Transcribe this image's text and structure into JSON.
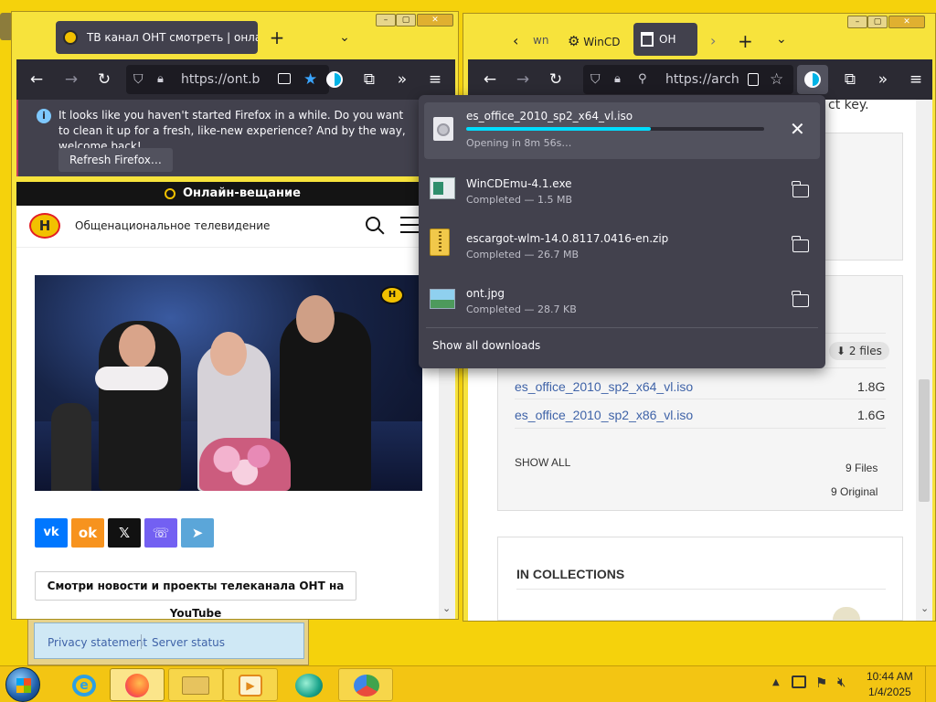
{
  "left_window": {
    "tab_title": "ТВ канал ОНТ смотреть | онлайн",
    "url_text": "https://ont.b",
    "notification": {
      "message": "It looks like you haven't started Firefox in a while. Do you want to clean it up for a fresh, like-new experience? And by the way, welcome back!",
      "button": "Refresh Firefox…"
    },
    "live_bar": "Онлайн-вещание",
    "site_title": "Общенациональное телевидение",
    "share_buttons": [
      "vk",
      "ok",
      "x",
      "viber",
      "telegram"
    ],
    "youtube_button": "Смотри новости и проекты телеканала ОНТ на YouTube"
  },
  "right_window": {
    "tabs": [
      "wn",
      "WinCD",
      "OH"
    ],
    "url_text": "https://arch",
    "page": {
      "top_snippet": "ct key.",
      "files_badge": "2 files",
      "files": [
        {
          "name": "es_office_2010_sp2_x64_vl.iso",
          "size": "1.8G"
        },
        {
          "name": "es_office_2010_sp2_x86_vl.iso",
          "size": "1.6G"
        }
      ],
      "show_all": "SHOW ALL",
      "files_count": "9 Files",
      "original_count": "9 Original",
      "collections_heading": "IN COLLECTIONS"
    }
  },
  "downloads_panel": {
    "items": [
      {
        "name": "es_office_2010_sp2_x64_vl.iso",
        "status": "Opening in 8m 56s…",
        "progress": 0.62,
        "action": "cancel"
      },
      {
        "name": "WinCDEmu-4.1.exe",
        "status": "Completed — 1.5 MB",
        "action": "folder"
      },
      {
        "name": "escargot-wlm-14.0.8117.0416-en.zip",
        "status": "Completed — 26.7 MB",
        "action": "folder"
      },
      {
        "name": "ont.jpg",
        "status": "Completed — 28.7 KB",
        "action": "folder"
      }
    ],
    "show_all": "Show all downloads"
  },
  "background_window": {
    "links": [
      "Privacy statement",
      "Server status"
    ]
  },
  "taskbar": {
    "time": "10:44 AM",
    "date": "1/4/2025",
    "apps": [
      "ie",
      "firefox",
      "file-explorer",
      "media-player",
      "messenger",
      "people"
    ]
  },
  "colors": {
    "desktop": "#f5d20c",
    "firefox_dark": "#2b2a33",
    "accent": "#00ddff",
    "link": "#3f63a8"
  }
}
